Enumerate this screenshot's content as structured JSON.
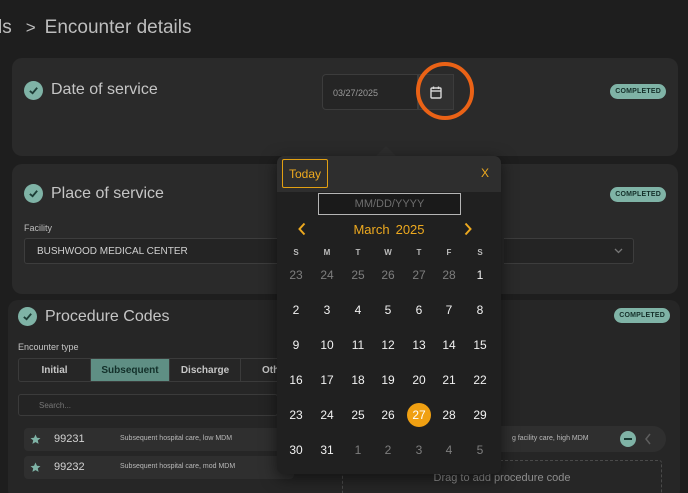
{
  "breadcrumb": {
    "previous": "ls",
    "separator": ">",
    "current": "Encounter details"
  },
  "status_color": "#7fb3a6",
  "accent_color": "#f0a012",
  "sections": {
    "date_of_service": {
      "title": "Date of service",
      "badge": "COMPLETED",
      "date_value": "03/27/2025",
      "calendar_icon": "calendar-icon"
    },
    "place_of_service": {
      "title": "Place of service",
      "badge": "COMPLETED",
      "facility_label": "Facility",
      "facility_value": "BUSHWOOD MEDICAL CENTER"
    },
    "procedure_codes": {
      "title": "Procedure Codes",
      "badge": "COMPLETED",
      "encounter_type_label": "Encounter type",
      "encounter_types": [
        "Initial",
        "Subsequent",
        "Discharge",
        "Oth"
      ],
      "active_encounter_type": "Subsequent",
      "search_placeholder": "Search...",
      "codes": [
        {
          "code": "99231",
          "description": "Subsequent hospital care, low MDM"
        },
        {
          "code": "99232",
          "description": "Subsequent hospital care, mod MDM"
        }
      ],
      "selected_code_description": "g facility care, high MDM",
      "drop_zone_text": "Drag to add procedure code"
    }
  },
  "datepicker": {
    "today_label": "Today",
    "close_label": "X",
    "input_placeholder": "MM/DD/YYYY",
    "month": "March",
    "year": "2025",
    "weekdays": [
      "S",
      "M",
      "T",
      "W",
      "T",
      "F",
      "S"
    ],
    "weeks": [
      [
        "23",
        "24",
        "25",
        "26",
        "27",
        "28",
        "1"
      ],
      [
        "2",
        "3",
        "4",
        "5",
        "6",
        "7",
        "8"
      ],
      [
        "9",
        "10",
        "11",
        "12",
        "13",
        "14",
        "15"
      ],
      [
        "16",
        "17",
        "18",
        "19",
        "20",
        "21",
        "22"
      ],
      [
        "23",
        "24",
        "25",
        "26",
        "27",
        "28",
        "29"
      ],
      [
        "30",
        "31",
        "1",
        "2",
        "3",
        "4",
        "5"
      ]
    ],
    "outside_month": [
      [
        0,
        0
      ],
      [
        0,
        1
      ],
      [
        0,
        2
      ],
      [
        0,
        3
      ],
      [
        0,
        4
      ],
      [
        0,
        5
      ],
      [
        5,
        2
      ],
      [
        5,
        3
      ],
      [
        5,
        4
      ],
      [
        5,
        5
      ],
      [
        5,
        6
      ]
    ],
    "selected_day": "27"
  }
}
